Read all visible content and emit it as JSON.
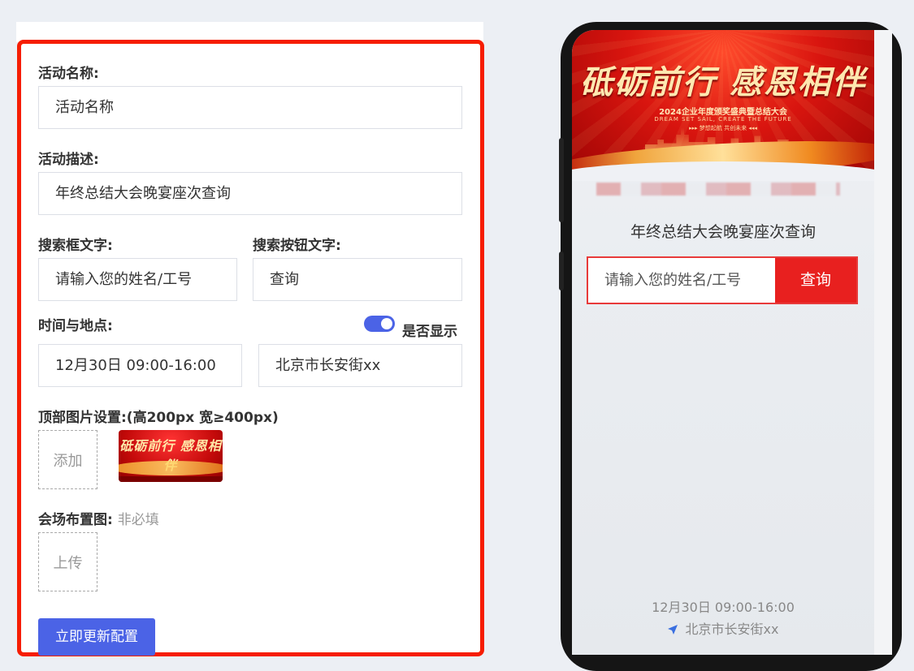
{
  "editor": {
    "activity_name": {
      "label": "活动名称:",
      "value": "活动名称"
    },
    "activity_desc": {
      "label": "活动描述:",
      "value": "年终总结大会晚宴座次查询"
    },
    "search_text": {
      "label": "搜索框文字:",
      "value": "请输入您的姓名/工号"
    },
    "search_button_text": {
      "label": "搜索按钮文字:",
      "value": "查询"
    },
    "time_place": {
      "label": "时间与地点:",
      "show_label": "是否显示",
      "show_enabled": true,
      "time_value": "12月30日 09:00-16:00",
      "place_value": "北京市长安街xx"
    },
    "top_image": {
      "label": "顶部图片设置:(高200px 宽≥400px)",
      "add_label": "添加"
    },
    "venue_map": {
      "label": "会场布置图:",
      "hint": "非必填",
      "upload_label": "上传"
    },
    "submit_label": "立即更新配置"
  },
  "preview": {
    "banner": {
      "title": "砥砺前行 感恩相伴",
      "subtitle": "2024企业年度颁奖盛典暨总结大会",
      "tagline_en": "DREAM SET SAIL, CREATE THE FUTURE",
      "tagline_cn": "▸▸▸ 梦想起航 共创未来 ◂◂◂"
    },
    "thumb_title": "砥砺前行 感恩相伴",
    "title": "年终总结大会晚宴座次查询",
    "search_placeholder": "请输入您的姓名/工号",
    "search_button": "查询",
    "time": "12月30日 09:00-16:00",
    "location": "北京市长安街xx"
  },
  "colors": {
    "accent_red": "#f61d00",
    "primary_blue": "#4b63e6",
    "search_red": "#e8201f"
  }
}
